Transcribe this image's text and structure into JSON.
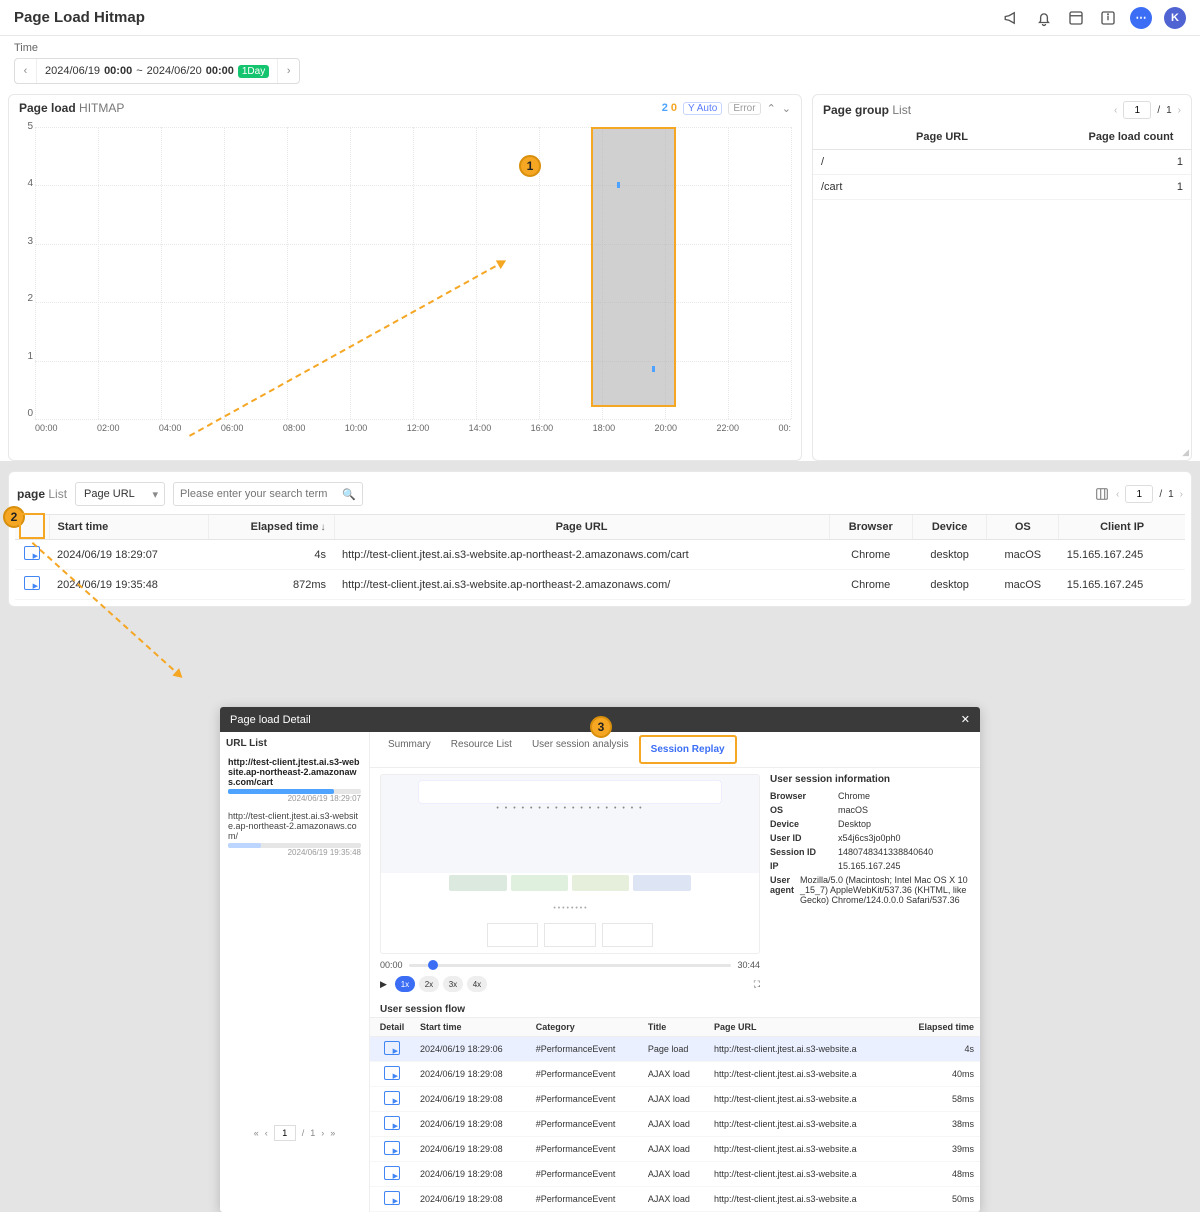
{
  "header": {
    "title": "Page Load Hitmap",
    "avatar_initial": "K"
  },
  "time": {
    "label": "Time",
    "range_from_date": "2024/06/19",
    "range_from_time": "00:00",
    "range_to_date": "2024/06/20",
    "range_to_time": "00:00",
    "badge": "1Day"
  },
  "hitmap": {
    "title_bold": "Page load",
    "title_light": "HITMAP",
    "stat_blue": "2",
    "stat_orange": "0",
    "pill_yauto": "Y Auto",
    "pill_error": "Error",
    "y_ticks": [
      "5",
      "4",
      "3",
      "2",
      "1",
      "0"
    ],
    "x_ticks": [
      "00:00",
      "02:00",
      "04:00",
      "06:00",
      "08:00",
      "10:00",
      "12:00",
      "14:00",
      "16:00",
      "18:00",
      "20:00",
      "22:00",
      "00:"
    ]
  },
  "chart_data": {
    "type": "scatter",
    "xlabel": "",
    "ylabel": "",
    "xlim": [
      "00:00",
      "24:00"
    ],
    "ylim": [
      0,
      5
    ],
    "series": [
      {
        "name": "page-load",
        "color": "#4da3ff",
        "points": [
          {
            "x": "18:29",
            "y": 4.0
          },
          {
            "x": "19:35",
            "y": 0.87
          }
        ]
      }
    ],
    "selection_box": {
      "x_from": "17:40",
      "x_to": "20:20",
      "y_from": 0.2,
      "y_to": 5.0
    }
  },
  "page_group": {
    "title_bold": "Page group",
    "title_light": "List",
    "page_current": "1",
    "page_total": "1",
    "col_url": "Page URL",
    "col_count": "Page load count",
    "rows": [
      {
        "url": "/",
        "count": "1"
      },
      {
        "url": "/cart",
        "count": "1"
      }
    ]
  },
  "page_list": {
    "title_bold": "page",
    "title_light": "List",
    "filter_selected": "Page URL",
    "search_placeholder": "Please enter your search term",
    "page_current": "1",
    "page_total": "1",
    "columns": {
      "start": "Start time",
      "elapsed": "Elapsed time",
      "url": "Page URL",
      "browser": "Browser",
      "device": "Device",
      "os": "OS",
      "ip": "Client IP"
    },
    "rows": [
      {
        "start": "2024/06/19 18:29:07",
        "elapsed": "4s",
        "url": "http://test-client.jtest.ai.s3-website.ap-northeast-2.amazonaws.com/cart",
        "browser": "Chrome",
        "device": "desktop",
        "os": "macOS",
        "ip": "15.165.167.245"
      },
      {
        "start": "2024/06/19 19:35:48",
        "elapsed": "872ms",
        "url": "http://test-client.jtest.ai.s3-website.ap-northeast-2.amazonaws.com/",
        "browser": "Chrome",
        "device": "desktop",
        "os": "macOS",
        "ip": "15.165.167.245"
      }
    ]
  },
  "callouts": {
    "one": "1",
    "two": "2",
    "three": "3"
  },
  "modal": {
    "title": "Page load Detail",
    "url_list_title": "URL List",
    "url_items": [
      {
        "url": "http://test-client.jtest.ai.s3-website.ap-northeast-2.amazonaws.com/cart",
        "ts": "2024/06/19 18:29:07",
        "fill": 80,
        "active": true
      },
      {
        "url": "http://test-client.jtest.ai.s3-website.ap-northeast-2.amazonaws.com/",
        "ts": "2024/06/19 19:35:48",
        "fill": 25,
        "active": false
      }
    ],
    "url_page_current": "1",
    "url_page_total": "1",
    "tabs": {
      "summary": "Summary",
      "resource": "Resource List",
      "user": "User session analysis",
      "replay": "Session Replay"
    },
    "player": {
      "time_start": "00:00",
      "time_end": "30:44",
      "speed": [
        "1x",
        "2x",
        "3x",
        "4x"
      ]
    },
    "session": {
      "title": "User session information",
      "kv": [
        {
          "k": "Browser",
          "v": "Chrome"
        },
        {
          "k": "OS",
          "v": "macOS"
        },
        {
          "k": "Device",
          "v": "Desktop"
        },
        {
          "k": "User ID",
          "v": "x54j6cs3jo0ph0"
        },
        {
          "k": "Session ID",
          "v": "1480748341338840640"
        },
        {
          "k": "IP",
          "v": "15.165.167.245"
        },
        {
          "k": "User agent",
          "v": "Mozilla/5.0 (Macintosh; Intel Mac OS X 10_15_7) AppleWebKit/537.36 (KHTML, like Gecko) Chrome/124.0.0.0 Safari/537.36"
        }
      ]
    },
    "flow": {
      "title": "User session flow",
      "cols": {
        "detail": "Detail",
        "start": "Start time",
        "cat": "Category",
        "title_c": "Title",
        "url": "Page URL",
        "elapsed": "Elapsed time"
      },
      "rows": [
        {
          "start": "2024/06/19 18:29:06",
          "cat": "#PerformanceEvent",
          "title": "Page load",
          "url": "http://test-client.jtest.ai.s3-website.a",
          "elapsed": "4s",
          "sel": true
        },
        {
          "start": "2024/06/19 18:29:08",
          "cat": "#PerformanceEvent",
          "title": "AJAX load",
          "url": "http://test-client.jtest.ai.s3-website.a",
          "elapsed": "40ms"
        },
        {
          "start": "2024/06/19 18:29:08",
          "cat": "#PerformanceEvent",
          "title": "AJAX load",
          "url": "http://test-client.jtest.ai.s3-website.a",
          "elapsed": "58ms"
        },
        {
          "start": "2024/06/19 18:29:08",
          "cat": "#PerformanceEvent",
          "title": "AJAX load",
          "url": "http://test-client.jtest.ai.s3-website.a",
          "elapsed": "38ms"
        },
        {
          "start": "2024/06/19 18:29:08",
          "cat": "#PerformanceEvent",
          "title": "AJAX load",
          "url": "http://test-client.jtest.ai.s3-website.a",
          "elapsed": "39ms"
        },
        {
          "start": "2024/06/19 18:29:08",
          "cat": "#PerformanceEvent",
          "title": "AJAX load",
          "url": "http://test-client.jtest.ai.s3-website.a",
          "elapsed": "48ms"
        },
        {
          "start": "2024/06/19 18:29:08",
          "cat": "#PerformanceEvent",
          "title": "AJAX load",
          "url": "http://test-client.jtest.ai.s3-website.a",
          "elapsed": "50ms"
        }
      ]
    }
  }
}
